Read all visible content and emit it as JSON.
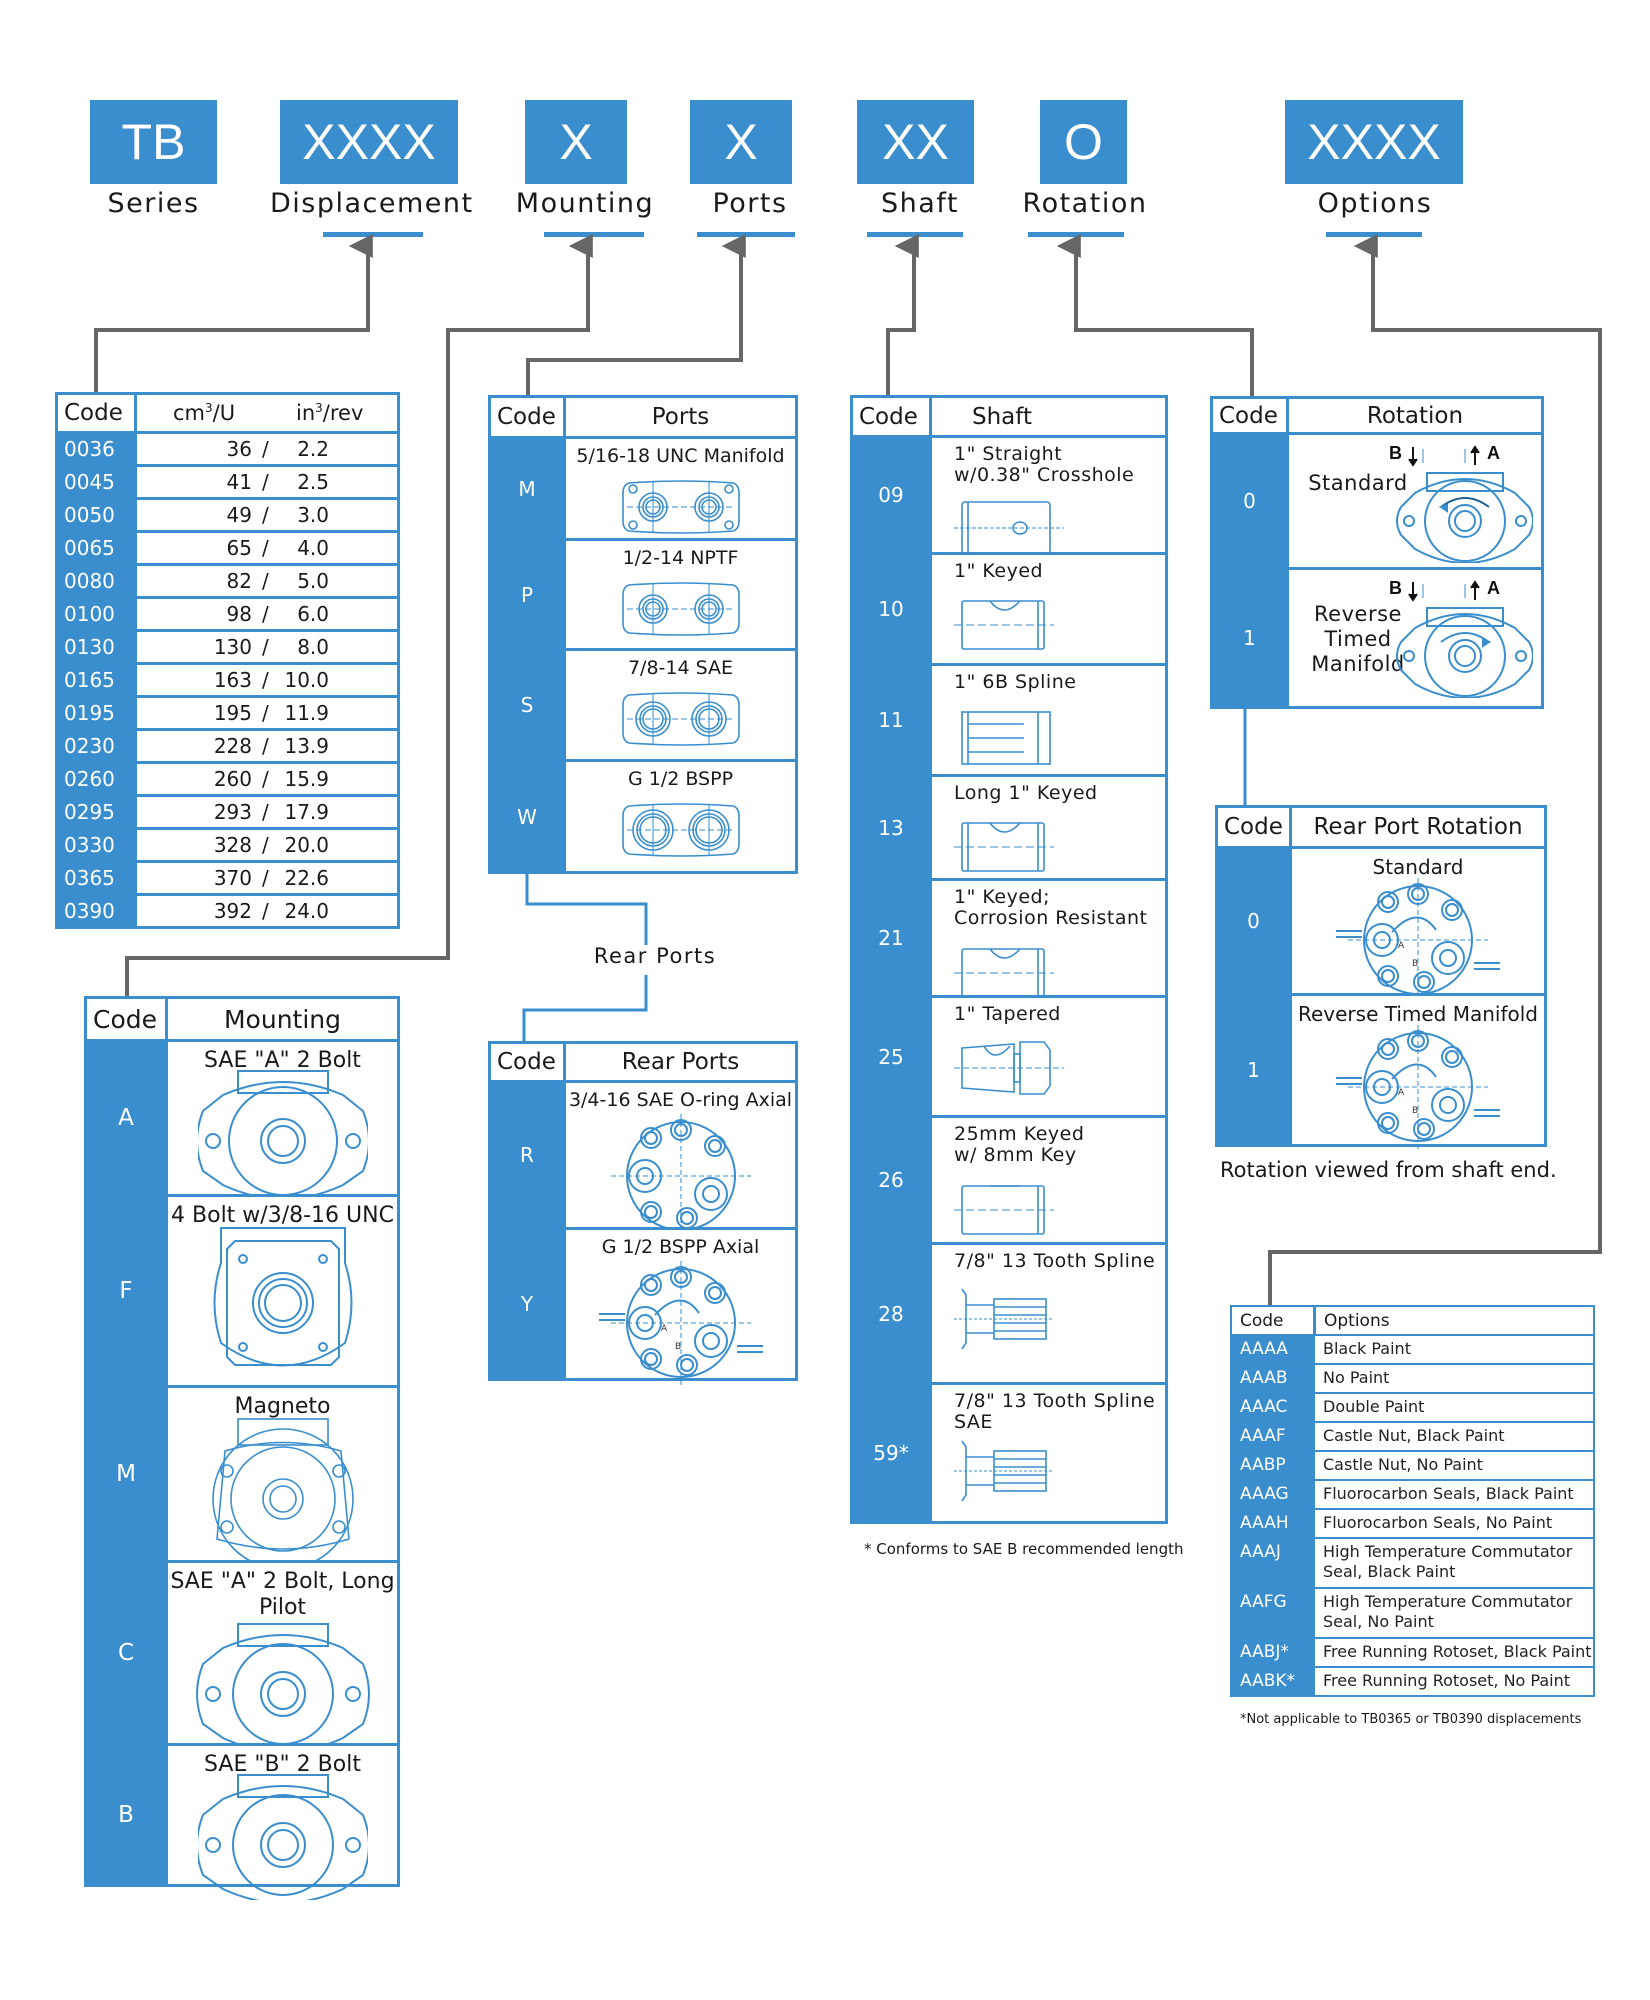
{
  "header": {
    "segments": [
      {
        "code": "TB",
        "label": "Series"
      },
      {
        "code": "XXXX",
        "label": "Displacement"
      },
      {
        "code": "X",
        "label": "Mounting"
      },
      {
        "code": "X",
        "label": "Ports"
      },
      {
        "code": "XX",
        "label": "Shaft"
      },
      {
        "code": "O",
        "label": "Rotation"
      },
      {
        "code": "XXXX",
        "label": "Options"
      }
    ]
  },
  "colors": {
    "accent": "#3a8ecd",
    "connector": "#666666",
    "text": "#1a1a1a"
  },
  "displacement": {
    "headers": {
      "code": "Code",
      "cm": "cm",
      "cm_sup": "3",
      "cm_unit": "/U",
      "in": "in",
      "in_sup": "3",
      "in_unit": "/rev"
    },
    "rows": [
      {
        "code": "0036",
        "cm3": "36",
        "in3": "2.2"
      },
      {
        "code": "0045",
        "cm3": "41",
        "in3": "2.5"
      },
      {
        "code": "0050",
        "cm3": "49",
        "in3": "3.0"
      },
      {
        "code": "0065",
        "cm3": "65",
        "in3": "4.0"
      },
      {
        "code": "0080",
        "cm3": "82",
        "in3": "5.0"
      },
      {
        "code": "0100",
        "cm3": "98",
        "in3": "6.0"
      },
      {
        "code": "0130",
        "cm3": "130",
        "in3": "8.0"
      },
      {
        "code": "0165",
        "cm3": "163",
        "in3": "10.0"
      },
      {
        "code": "0195",
        "cm3": "195",
        "in3": "11.9"
      },
      {
        "code": "0230",
        "cm3": "228",
        "in3": "13.9"
      },
      {
        "code": "0260",
        "cm3": "260",
        "in3": "15.9"
      },
      {
        "code": "0295",
        "cm3": "293",
        "in3": "17.9"
      },
      {
        "code": "0330",
        "cm3": "328",
        "in3": "20.0"
      },
      {
        "code": "0365",
        "cm3": "370",
        "in3": "22.6"
      },
      {
        "code": "0390",
        "cm3": "392",
        "in3": "24.0"
      }
    ],
    "separator": "/"
  },
  "mounting": {
    "headers": {
      "code": "Code",
      "desc": "Mounting"
    },
    "rows": [
      {
        "code": "A",
        "desc": "SAE \"A\" 2 Bolt",
        "icon": "sae-a-2-bolt-flange-icon"
      },
      {
        "code": "F",
        "desc": "4 Bolt w/3/8-16 UNC",
        "icon": "4-bolt-flange-icon"
      },
      {
        "code": "M",
        "desc": "Magneto",
        "icon": "magneto-flange-icon"
      },
      {
        "code": "C",
        "desc": "SAE \"A\" 2 Bolt, Long Pilot",
        "icon": "sae-a-long-pilot-flange-icon"
      },
      {
        "code": "B",
        "desc": "SAE \"B\" 2 Bolt",
        "icon": "sae-b-2-bolt-flange-icon"
      }
    ]
  },
  "ports": {
    "headers": {
      "code": "Code",
      "desc": "Ports"
    },
    "rows": [
      {
        "code": "M",
        "desc": "5/16-18 UNC Manifold",
        "icon": "manifold-port-icon"
      },
      {
        "code": "P",
        "desc": "1/2-14 NPTF",
        "icon": "nptf-port-icon"
      },
      {
        "code": "S",
        "desc": "7/8-14 SAE",
        "icon": "sae-port-icon"
      },
      {
        "code": "W",
        "desc": "G 1/2 BSPP",
        "icon": "bspp-port-icon"
      }
    ]
  },
  "rear_ports_link": {
    "label": "Rear Ports"
  },
  "rear_ports": {
    "headers": {
      "code": "Code",
      "desc": "Rear Ports"
    },
    "rows": [
      {
        "code": "R",
        "desc": "3/4-16 SAE O-ring Axial",
        "icon": "rear-port-axial-icon"
      },
      {
        "code": "Y",
        "desc": "G 1/2 BSPP Axial",
        "icon": "rear-port-bspp-axial-icon"
      }
    ]
  },
  "shaft": {
    "headers": {
      "code": "Code",
      "desc": "Shaft"
    },
    "rows": [
      {
        "code": "09",
        "desc": "1\" Straight\nw/0.38\" Crosshole",
        "icon": "straight-crosshole-shaft-icon"
      },
      {
        "code": "10",
        "desc": "1\" Keyed",
        "icon": "keyed-shaft-icon"
      },
      {
        "code": "11",
        "desc": "1\" 6B Spline",
        "icon": "spline-shaft-icon"
      },
      {
        "code": "13",
        "desc": "Long 1\" Keyed",
        "icon": "long-keyed-shaft-icon"
      },
      {
        "code": "21",
        "desc": "1\" Keyed;\nCorrosion  Resistant",
        "icon": "keyed-shaft-icon"
      },
      {
        "code": "25",
        "desc": "1\" Tapered",
        "icon": "tapered-shaft-icon"
      },
      {
        "code": "26",
        "desc": "25mm Keyed\nw/ 8mm Key",
        "icon": "metric-keyed-shaft-icon"
      },
      {
        "code": "28",
        "desc": "7/8\"  13 Tooth Spline",
        "icon": "13-tooth-spline-shaft-icon"
      },
      {
        "code": "59*",
        "desc": "7/8\"  13 Tooth Spline\nSAE",
        "icon": "13-tooth-spline-sae-shaft-icon"
      }
    ],
    "footnote": "* Conforms to SAE B recommended length"
  },
  "rotation": {
    "headers": {
      "code": "Code",
      "desc": "Rotation"
    },
    "port_labels": {
      "b": "B",
      "a": "A"
    },
    "rows": [
      {
        "code": "0",
        "desc": "Standard",
        "icon": "standard-rotation-icon"
      },
      {
        "code": "1",
        "desc": "Reverse\nTimed\nManifold",
        "icon": "reverse-rotation-icon"
      }
    ]
  },
  "rear_port_rotation": {
    "headers": {
      "code": "Code",
      "desc": "Rear Port  Rotation"
    },
    "port_labels": {
      "a": "A",
      "b": "B"
    },
    "rows": [
      {
        "code": "0",
        "desc": "Standard",
        "icon": "rear-standard-rotation-icon"
      },
      {
        "code": "1",
        "desc": "Reverse Timed Manifold",
        "icon": "rear-reverse-rotation-icon"
      }
    ],
    "footnote": "Rotation viewed from shaft end."
  },
  "options": {
    "headers": {
      "code": "Code",
      "desc": "Options"
    },
    "rows": [
      {
        "code": "AAAA",
        "desc": "Black Paint"
      },
      {
        "code": "AAAB",
        "desc": "No Paint"
      },
      {
        "code": "AAAC",
        "desc": "Double Paint"
      },
      {
        "code": "AAAF",
        "desc": "Castle Nut, Black Paint"
      },
      {
        "code": "AABP",
        "desc": "Castle Nut, No Paint"
      },
      {
        "code": "AAAG",
        "desc": "Fluorocarbon Seals, Black Paint"
      },
      {
        "code": "AAAH",
        "desc": "Fluorocarbon Seals, No Paint"
      },
      {
        "code": "AAAJ",
        "desc": "High Temperature Commutator\nSeal, Black Paint"
      },
      {
        "code": "AAFG",
        "desc": "High Temperature Commutator\nSeal, No Paint"
      },
      {
        "code": "AABJ*",
        "desc": "Free Running Rotoset, Black Paint"
      },
      {
        "code": "AABK*",
        "desc": "Free Running Rotoset, No Paint"
      }
    ],
    "footnote": "*Not applicable to TB0365 or TB0390 displacements"
  }
}
